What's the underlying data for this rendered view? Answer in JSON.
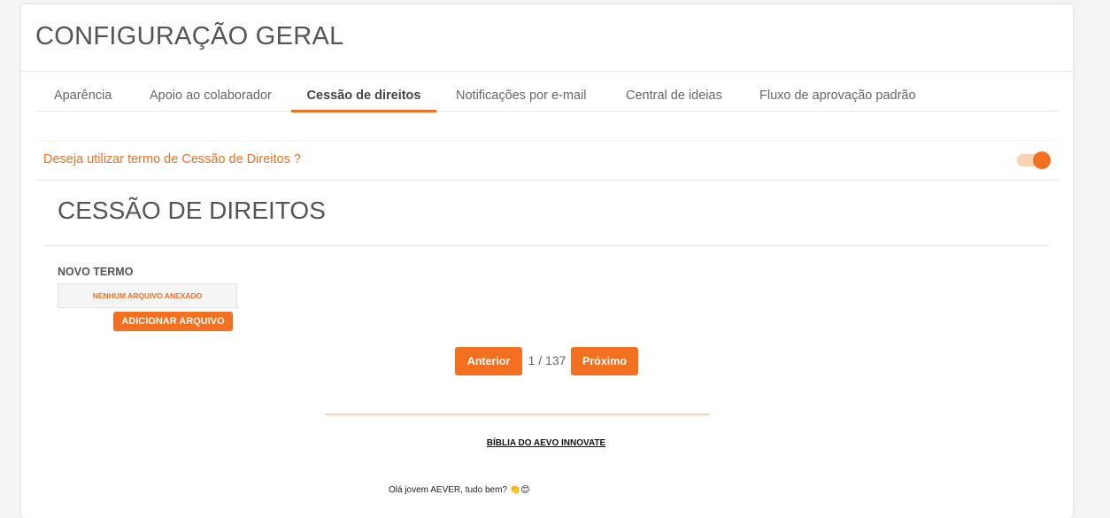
{
  "header": {
    "title": "CONFIGURAÇÃO GERAL"
  },
  "tabs": [
    {
      "label": "Aparência",
      "active": false
    },
    {
      "label": "Apoio ao colaborador",
      "active": false
    },
    {
      "label": "Cessão de direitos",
      "active": true
    },
    {
      "label": "Notificações por e-mail",
      "active": false
    },
    {
      "label": "Central de ideias",
      "active": false
    },
    {
      "label": "Fluxo de aprovação padrão",
      "active": false
    }
  ],
  "toggle_setting": {
    "label": "Deseja utilizar termo de Cessão de Direitos ?",
    "enabled": true
  },
  "section": {
    "title": "CESSÃO DE DIREITOS",
    "new_term_label": "NOVO TERMO",
    "file_status": "NENHUM ARQUIVO ANEXADO",
    "add_file_label": "ADICIONAR ARQUIVO"
  },
  "pagination": {
    "prev_label": "Anterior",
    "next_label": "Próximo",
    "counter": "1 / 137"
  },
  "document": {
    "heading": "BÍBLIA DO AEVO INNOVATE",
    "first_line": "Olá jovem AEVER, tudo bem? 👏😊"
  },
  "colors": {
    "accent": "#f37021",
    "accent_light": "#fbd2b6",
    "text": "#555555",
    "background": "#f4f4f4"
  }
}
